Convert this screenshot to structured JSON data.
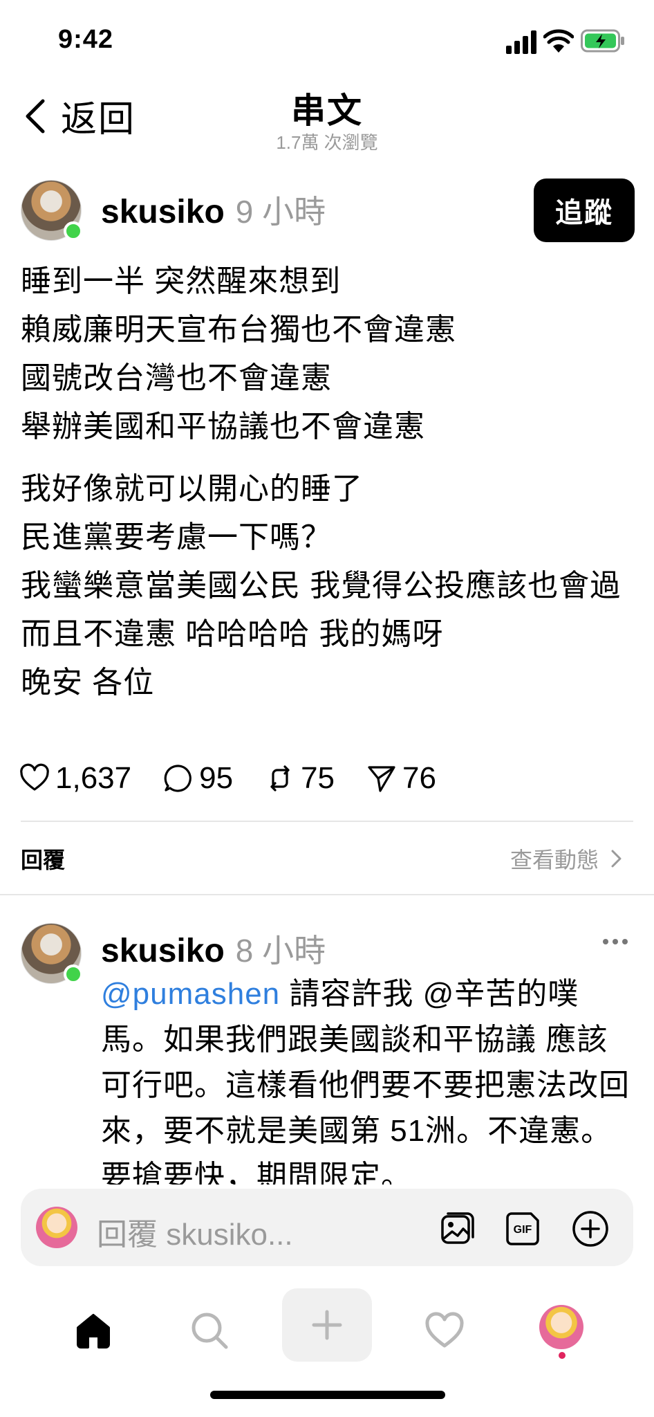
{
  "status": {
    "time": "9:42"
  },
  "nav": {
    "back_label": "返回",
    "title": "串文",
    "subtitle": "1.7萬 次瀏覽"
  },
  "post": {
    "username": "skusiko",
    "time": "9 小時",
    "follow_label": "追蹤",
    "lines": [
      "睡到一半 突然醒來想到",
      "賴威廉明天宣布台獨也不會違憲",
      "國號改台灣也不會違憲",
      "舉辦美國和平協議也不會違憲",
      "我好像就可以開心的睡了",
      "民進黨要考慮一下嗎？",
      "我蠻樂意當美國公民 我覺得公投應該也會過",
      "而且不違憲 哈哈哈哈 我的媽呀",
      "晚安 各位"
    ],
    "likes": "1,637",
    "comments": "95",
    "reposts": "75",
    "shares": "76"
  },
  "replies_section": {
    "label": "回覆",
    "activity_label": "查看動態"
  },
  "reply": {
    "username": "skusiko",
    "time": "8 小時",
    "mention": "@pumashen",
    "text": " 請容許我 @辛苦的噗馬。如果我們跟美國談和平協議 應該可行吧。這樣看他們要不要把憲法改回來，要不就是美國第 51洲。不違憲。要搶要快，期間限定。"
  },
  "composer": {
    "placeholder": "回覆 skusiko..."
  },
  "colors": {
    "accent": "#2f7fde",
    "online": "#41d34a",
    "battery": "#34c759"
  }
}
